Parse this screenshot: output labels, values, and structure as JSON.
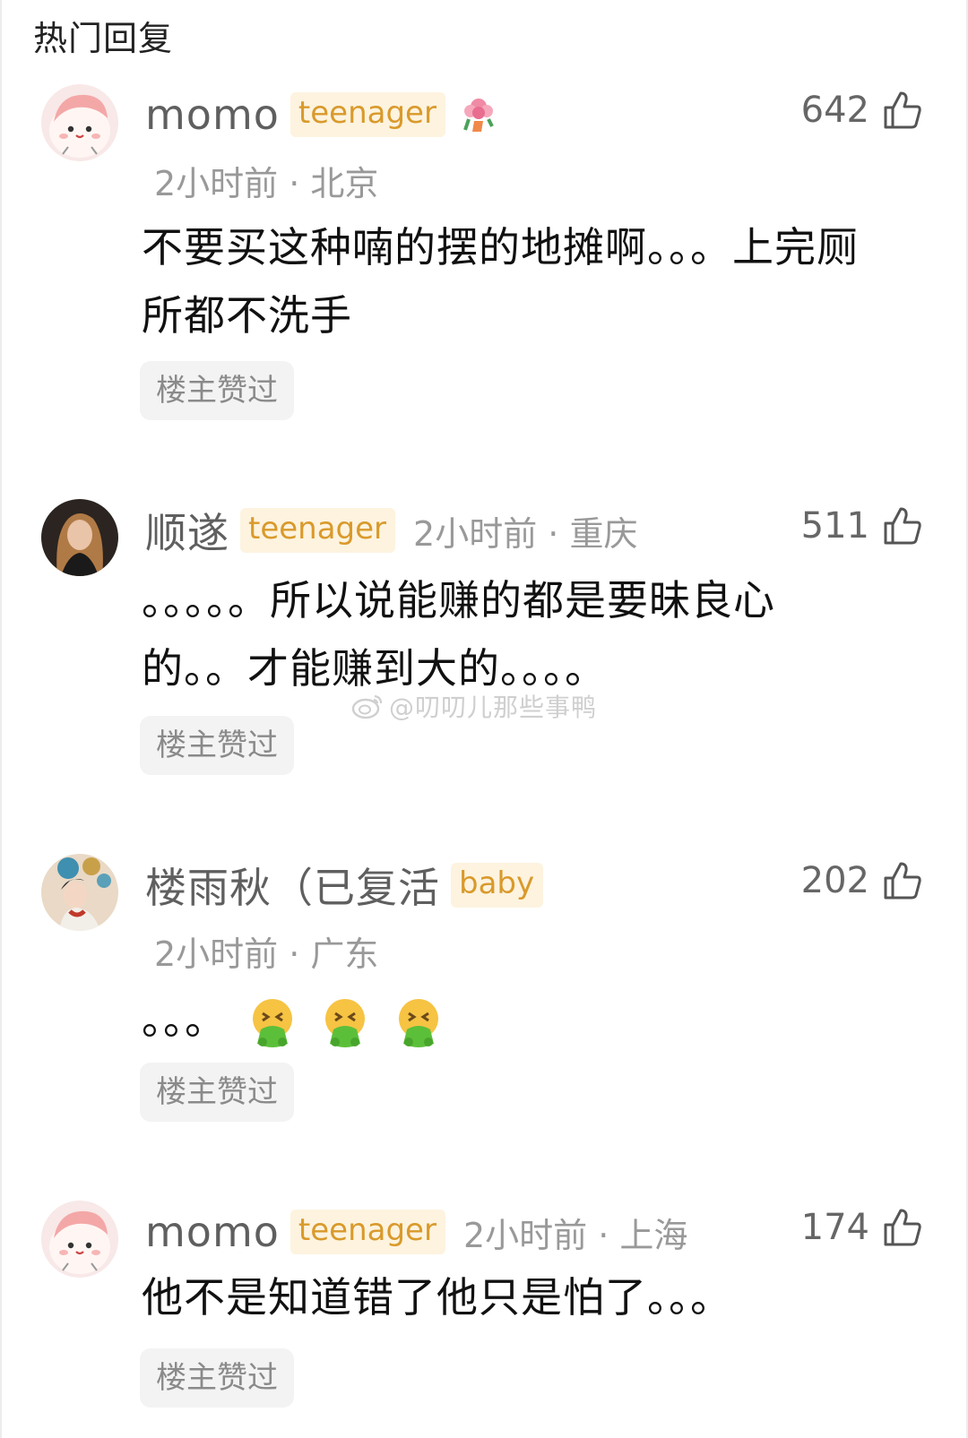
{
  "section": {
    "title": "热门回复"
  },
  "comments": [
    {
      "username": "momo",
      "badge": "teenager",
      "meta": "2小时前 · 北京",
      "likes": "642",
      "content": "不要买这种喃的摆的地摊啊。。。上完厕所都不洗手",
      "tag": "楼主赞过",
      "avatar_icon": "pink-cartoon-face",
      "sticker_icon": "flower-sticker"
    },
    {
      "username": "顺遂",
      "badge": "teenager",
      "meta": "2小时前 · 重庆",
      "likes": "511",
      "content": "。。。。。所以说能赚的都是要昧良心的。。才能赚到大的。。。。",
      "tag": "楼主赞过",
      "avatar_icon": "woman-portrait"
    },
    {
      "username": "楼雨秋（已复活",
      "badge": "baby",
      "meta": "2小时前 · 广东",
      "likes": "202",
      "content": "。。。",
      "emojis": [
        "vomit-emoji",
        "vomit-emoji",
        "vomit-emoji"
      ],
      "tag": "楼主赞过",
      "avatar_icon": "illustrated-girl"
    },
    {
      "username": "momo",
      "badge": "teenager",
      "meta": "2小时前 · 上海",
      "likes": "174",
      "content": "他不是知道错了他只是怕了。。。",
      "tag": "楼主赞过",
      "avatar_icon": "pink-cartoon-face"
    }
  ],
  "watermark": {
    "text": "@叨叨儿那些事鸭",
    "icon": "weibo-logo-icon"
  }
}
